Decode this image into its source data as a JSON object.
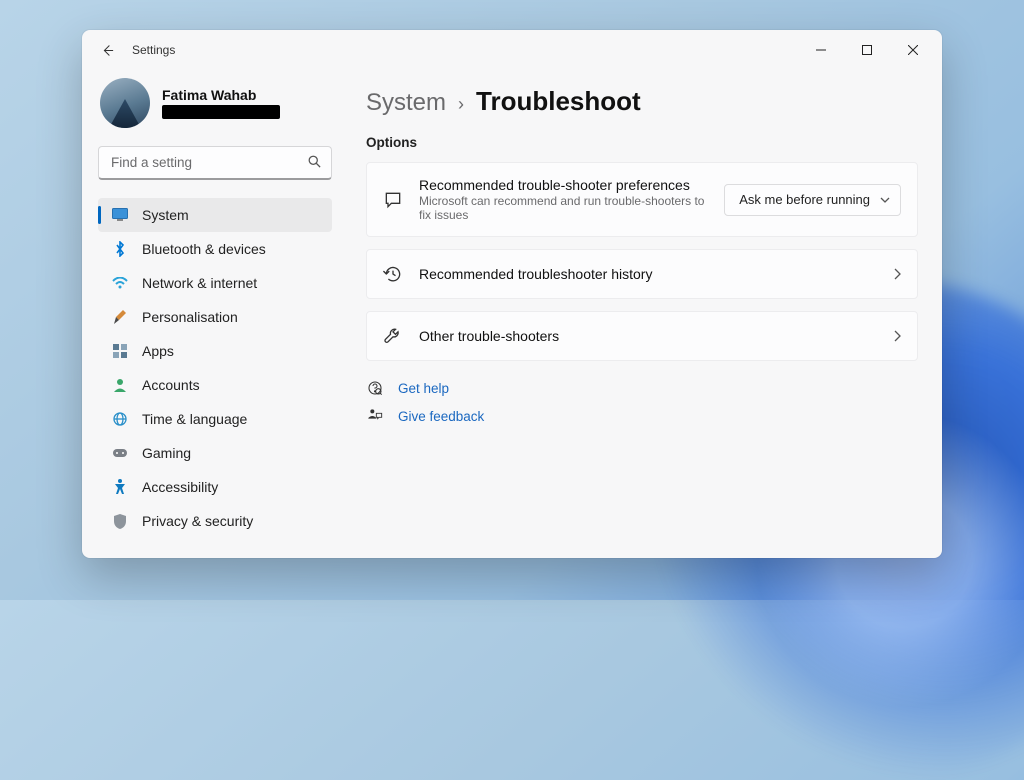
{
  "titlebar": {
    "title": "Settings"
  },
  "profile": {
    "name": "Fatima Wahab"
  },
  "search": {
    "placeholder": "Find a setting"
  },
  "sidebar": {
    "items": [
      {
        "label": "System",
        "icon": "display-icon",
        "active": true
      },
      {
        "label": "Bluetooth & devices",
        "icon": "bluetooth-icon"
      },
      {
        "label": "Network & internet",
        "icon": "wifi-icon"
      },
      {
        "label": "Personalisation",
        "icon": "brush-icon"
      },
      {
        "label": "Apps",
        "icon": "apps-icon"
      },
      {
        "label": "Accounts",
        "icon": "person-icon"
      },
      {
        "label": "Time & language",
        "icon": "globe-icon"
      },
      {
        "label": "Gaming",
        "icon": "gamepad-icon"
      },
      {
        "label": "Accessibility",
        "icon": "accessibility-icon"
      },
      {
        "label": "Privacy & security",
        "icon": "shield-icon"
      }
    ]
  },
  "breadcrumb": {
    "parent": "System",
    "current": "Troubleshoot"
  },
  "section": {
    "heading": "Options"
  },
  "cards": {
    "pref": {
      "title": "Recommended trouble-shooter preferences",
      "subtitle": "Microsoft can recommend and run trouble-shooters to fix issues",
      "dropdown": "Ask me before running"
    },
    "history": {
      "title": "Recommended troubleshooter history"
    },
    "other": {
      "title": "Other trouble-shooters"
    }
  },
  "links": {
    "help": "Get help",
    "feedback": "Give feedback"
  }
}
